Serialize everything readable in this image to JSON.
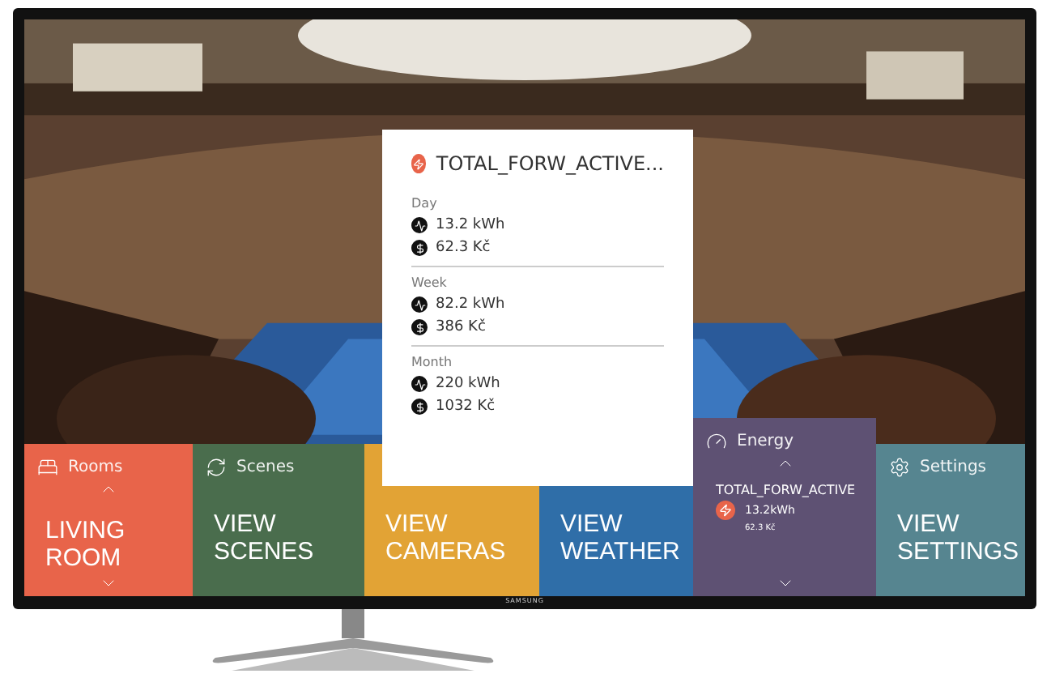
{
  "tv": {
    "brand": "SAMSUNG"
  },
  "popup": {
    "title": "TOTAL_FORW_ACTIVE...",
    "sections": [
      {
        "label": "Day",
        "rows": [
          {
            "kind": "energy",
            "text": "13.2 kWh"
          },
          {
            "kind": "cost",
            "text": "62.3 Kč"
          }
        ]
      },
      {
        "label": "Week",
        "rows": [
          {
            "kind": "energy",
            "text": "82.2 kWh"
          },
          {
            "kind": "cost",
            "text": "386 Kč"
          }
        ]
      },
      {
        "label": "Month",
        "rows": [
          {
            "kind": "energy",
            "text": "220 kWh"
          },
          {
            "kind": "cost",
            "text": "1032 Kč"
          }
        ]
      }
    ]
  },
  "tiles": [
    {
      "kind": "room",
      "header": "Rooms",
      "title": "LIVING ROOM",
      "color": "#e8644a",
      "selected": false
    },
    {
      "kind": "scenes",
      "header": "Scenes",
      "title": "VIEW SCENES",
      "color": "#4a6d4d",
      "selected": false
    },
    {
      "kind": "link",
      "title": "VIEW CAMERAS",
      "color": "#e2a335",
      "selected": false
    },
    {
      "kind": "link",
      "title": "VIEW WEATHER",
      "color": "#2f6ea8",
      "selected": false
    },
    {
      "kind": "energy",
      "header": "Energy",
      "sensor": "TOTAL_FORW_ACTIVE",
      "value": "13.2kWh",
      "cost": "62.3 Kč",
      "color": "#5e5173",
      "selected": true
    },
    {
      "kind": "settings",
      "header": "Settings",
      "title": "VIEW SETTINGS",
      "color": "#568590",
      "selected": false
    }
  ]
}
